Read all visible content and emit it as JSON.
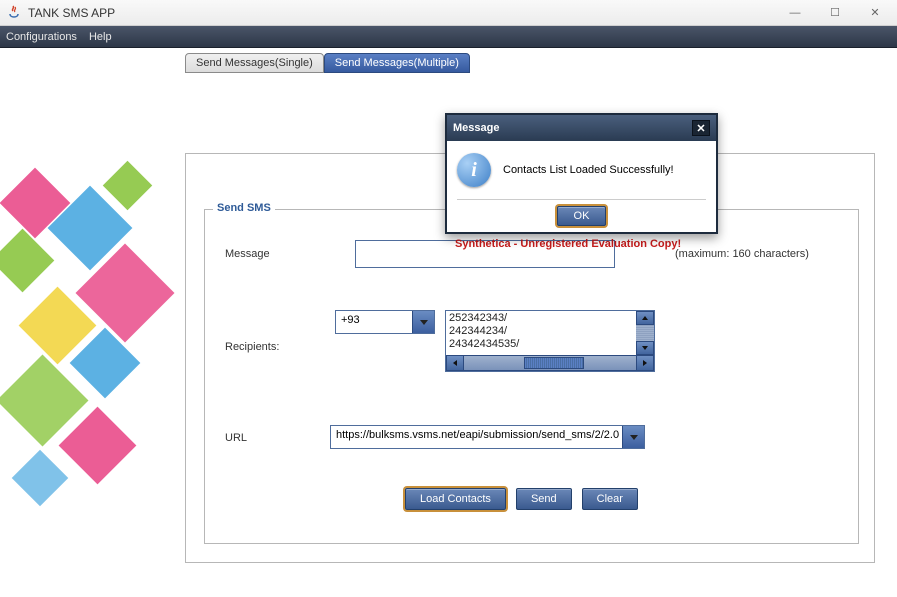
{
  "window": {
    "title": "TANK SMS APP",
    "min": "—",
    "max": "☐",
    "close": "✕"
  },
  "menu": {
    "configurations": "Configurations",
    "help": "Help"
  },
  "tabs": {
    "single": "Send Messages(Single)",
    "multiple": "Send Messages(Multiple)"
  },
  "fieldset": {
    "legend": "Send SMS",
    "message_label": "Message",
    "max_chars": "(maximum: 160 characters)",
    "recipients_label": "Recipients:",
    "url_label": "URL",
    "country_code": "+93",
    "recipients": [
      "252342343/",
      "242344234/",
      "24342434535/"
    ],
    "url_value": "https://bulksms.vsms.net/eapi/submission/send_sms/2/2.0",
    "message_value": ""
  },
  "buttons": {
    "load": "Load Contacts",
    "send": "Send",
    "clear": "Clear"
  },
  "warning": "Synthetica - Unregistered Evaluation Copy!",
  "dialog": {
    "title": "Message",
    "text": "Contacts List Loaded Successfully!",
    "ok": "OK",
    "close": "✕"
  }
}
